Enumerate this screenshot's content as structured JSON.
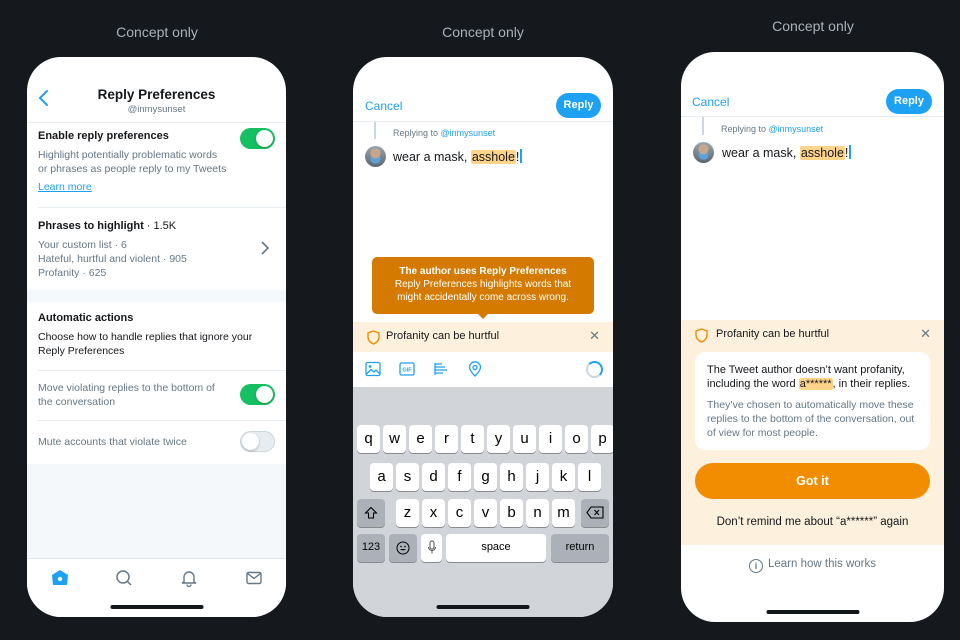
{
  "captions": [
    "Concept only",
    "Concept only",
    "Concept only"
  ],
  "settings_screen": {
    "title": "Reply Preferences",
    "handle": "@inmysunset",
    "enable": {
      "title": "Enable reply preferences",
      "description_line1": "Highlight potentially problematic words",
      "description_line2": "or phrases as people reply to my Tweets",
      "learn_more": "Learn more",
      "enabled": true
    },
    "phrases": {
      "title": "Phrases to highlight",
      "count": " · 1.5K",
      "items": [
        "Your custom list · 6",
        "Hateful, hurtful and violent · 905",
        "Profanity · 625"
      ]
    },
    "automatic": {
      "title": "Automatic actions",
      "description_line1": "Choose how to handle replies that ignore your",
      "description_line2": "Reply Preferences",
      "move_label_line1": "Move violating replies to the bottom of",
      "move_label_line2": "the conversation",
      "move_enabled": true,
      "mute_label": "Mute accounts that violate twice",
      "mute_enabled": false
    },
    "tabbar": [
      "home",
      "search",
      "notifications",
      "messages"
    ],
    "accent_color": "#1da1f2",
    "toggle_on_color": "#17bf63"
  },
  "compose_screen": {
    "cancel": "Cancel",
    "reply": "Reply",
    "replying_prefix": "Replying to ",
    "replying_handle": "@inmysunset",
    "text_before": "wear a mask, ",
    "text_highlight": "asshole",
    "text_after": "!",
    "tooltip_title": "The author uses Reply Preferences",
    "tooltip_line1": "Reply Preferences highlights words that",
    "tooltip_line2": "might accidentally come across wrong.",
    "warning": "Profanity can be hurtful",
    "toolbar_icons": [
      "image",
      "gif",
      "poll",
      "location"
    ],
    "keyboard": {
      "row1": [
        "q",
        "w",
        "e",
        "r",
        "t",
        "y",
        "u",
        "i",
        "o",
        "p"
      ],
      "row2": [
        "a",
        "s",
        "d",
        "f",
        "g",
        "h",
        "j",
        "k",
        "l"
      ],
      "row3": [
        "z",
        "x",
        "c",
        "v",
        "b",
        "n",
        "m"
      ],
      "numbers": "123",
      "space": "space",
      "return": "return"
    },
    "tooltip_color": "#d47a00",
    "highlight_color": "#ffd48a"
  },
  "warning_screen": {
    "cancel": "Cancel",
    "reply": "Reply",
    "replying_prefix": "Replying to ",
    "replying_handle": "@inmysunset",
    "text_before": "wear a mask, ",
    "text_highlight": "asshole",
    "text_after": "!",
    "warning": "Profanity can be hurtful",
    "card_main_before": "The Tweet author doesn’t want profanity, including the word ",
    "card_main_word": "a******",
    "card_main_after": ", in their replies.",
    "card_sub": "They’ve chosen to automatically move these replies to the bottom of the conversation, out of view for most people.",
    "got_it": "Got it",
    "dont_remind": "Don’t remind me about “a******” again",
    "learn_how": "Learn how this works",
    "button_color": "#f28c00"
  }
}
